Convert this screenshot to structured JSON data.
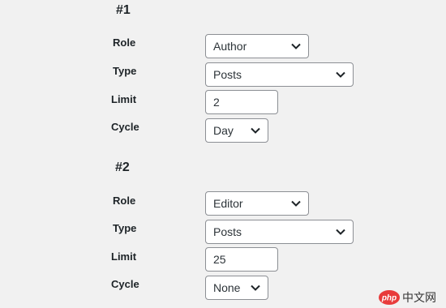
{
  "rules": [
    {
      "heading": "#1",
      "role_label": "Role",
      "role_value": "Author",
      "type_label": "Type",
      "type_value": "Posts",
      "limit_label": "Limit",
      "limit_value": "2",
      "cycle_label": "Cycle",
      "cycle_value": "Day"
    },
    {
      "heading": "#2",
      "role_label": "Role",
      "role_value": "Editor",
      "type_label": "Type",
      "type_value": "Posts",
      "limit_label": "Limit",
      "limit_value": "25",
      "cycle_label": "Cycle",
      "cycle_value": "None"
    }
  ],
  "icons": {
    "dropdown": "chevron-down-icon",
    "watermark": "php-cn-logo"
  },
  "watermark": {
    "text_php": "php",
    "text_cn": "中文网"
  },
  "colors": {
    "background": "#f1f1f1",
    "field_border": "#8c8f94",
    "text": "#1d2327"
  }
}
